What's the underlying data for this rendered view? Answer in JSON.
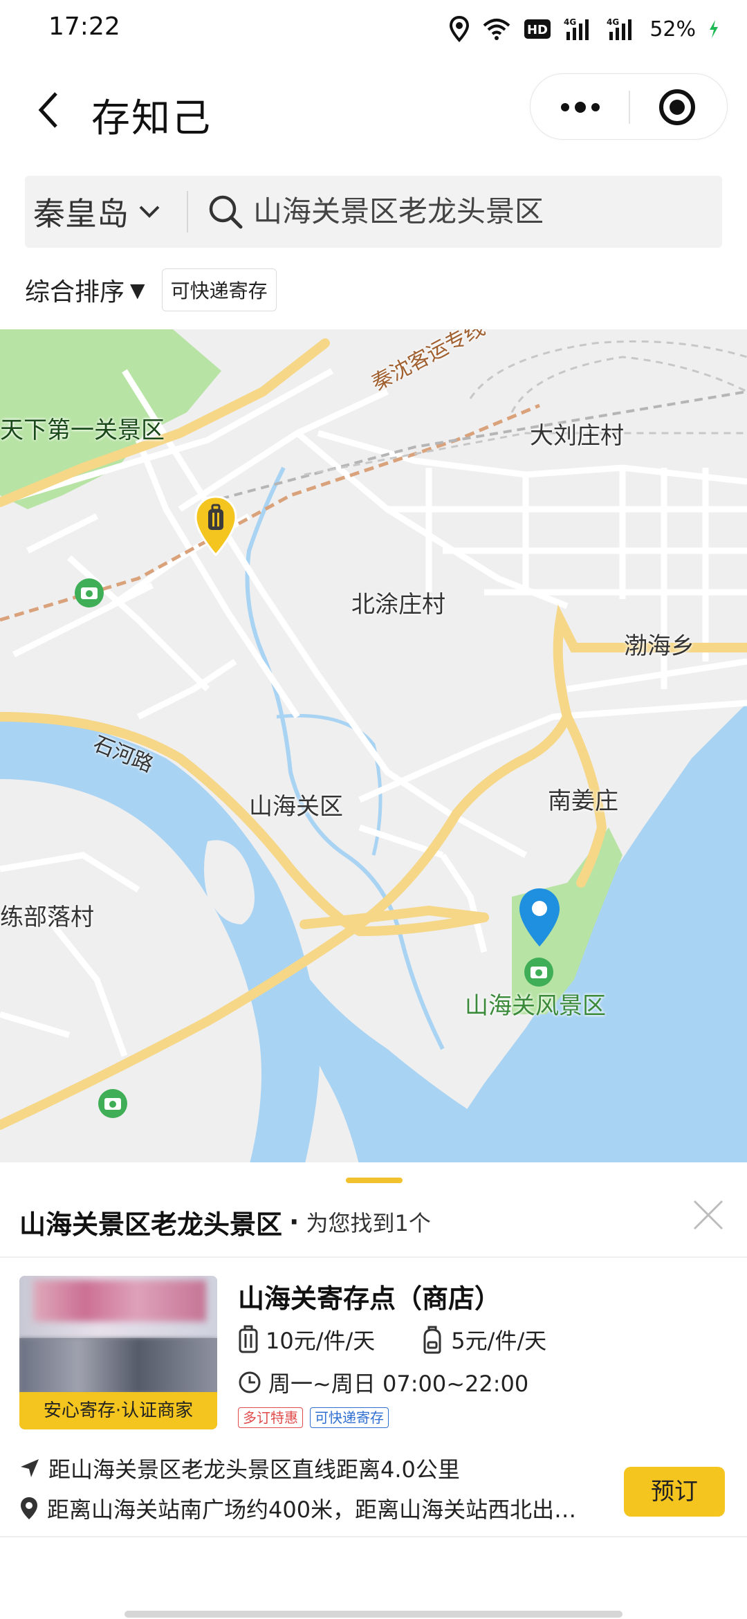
{
  "status_bar": {
    "time": "17:22",
    "network_1": "4G",
    "network_2": "4G",
    "hd_label": "HD",
    "battery": "52%"
  },
  "nav": {
    "title": "存知己"
  },
  "search": {
    "city": "秦皇岛",
    "query": "山海关景区老龙头景区"
  },
  "filters": {
    "sort_label": "综合排序",
    "sort_arrow": "▼",
    "chip_label": "可快递寄存"
  },
  "map": {
    "labels": {
      "railway": "秦沈客运专线",
      "scenic_1": "天下第一关景区",
      "village_1": "大刘庄村",
      "village_2": "北涂庄村",
      "town_1": "渤海乡",
      "road_1": "石河路",
      "district": "山海关区",
      "village_3": "南姜庄",
      "village_4": "练部落村",
      "scenic_2": "山海关风景区"
    },
    "colors": {
      "land": "#efeff0",
      "water": "#a9d3f3",
      "park": "#b7e3a4",
      "main_road": "#f6d788",
      "road": "#ffffff",
      "pin_blue": "#1f8fe0",
      "pin_yellow": "#f4c51f"
    }
  },
  "sheet": {
    "location_title": "山海关景区老龙头景区",
    "dot": "·",
    "found_text": "为您找到1个",
    "store": {
      "name": "山海关寄存点（商店）",
      "badge": "安心寄存·认证商家",
      "price_large": "10元/件/天",
      "price_small": "5元/件/天",
      "hours": "周一~周日 07:00~22:00",
      "tag_1": "多订特惠",
      "tag_2": "可快递寄存",
      "distance": "距山海关景区老龙头景区直线距离4.0公里",
      "address": "距离山海关站南广场约400米，距离山海关站西北出…",
      "book_label": "预订"
    }
  }
}
